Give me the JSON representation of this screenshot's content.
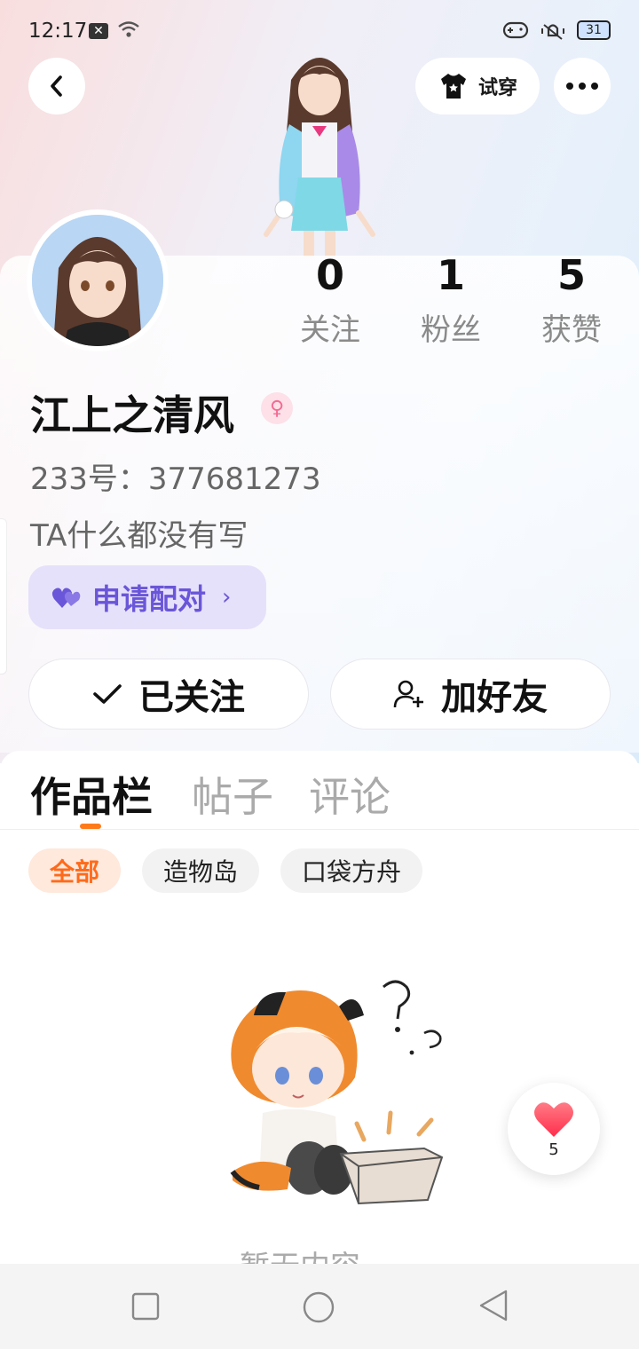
{
  "status_bar": {
    "time": "12:17",
    "battery": "31"
  },
  "header": {
    "try_on_label": "试穿"
  },
  "stats": [
    {
      "value": "0",
      "label": "关注"
    },
    {
      "value": "1",
      "label": "粉丝"
    },
    {
      "value": "5",
      "label": "获赞"
    }
  ],
  "profile": {
    "username": "江上之清风",
    "uid": "233号：377681273",
    "bio": "TA什么都没有写",
    "pair_label": "申请配对"
  },
  "actions": {
    "follow_label": "已关注",
    "add_friend_label": "加好友"
  },
  "tabs": [
    {
      "label": "作品栏"
    },
    {
      "label": "帖子"
    },
    {
      "label": "评论"
    }
  ],
  "filters": [
    {
      "label": "全部"
    },
    {
      "label": "造物岛"
    },
    {
      "label": "口袋方舟"
    }
  ],
  "empty_state": {
    "text": "暂无内容"
  },
  "like_fab": {
    "count": "5"
  },
  "colors": {
    "accent": "#ff7a1a",
    "pair": "#6a56d8",
    "like": "#ff4d5e"
  }
}
